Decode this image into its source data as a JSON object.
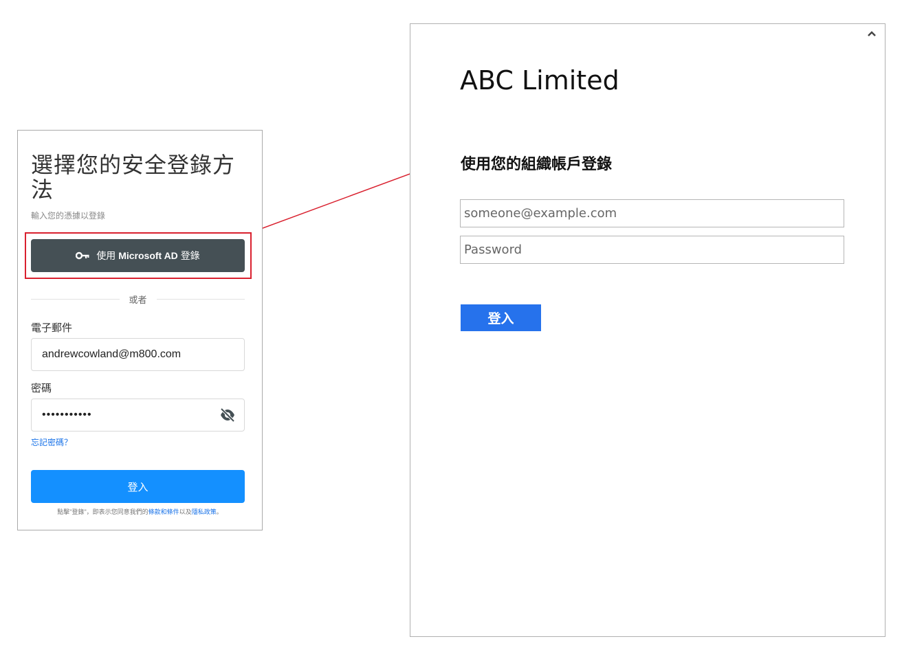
{
  "left_card": {
    "title": "選擇您的安全登錄方法",
    "subtitle": "輸入您的憑據以登錄",
    "ms_button": {
      "prefix": "使用",
      "brand": "Microsoft AD",
      "suffix": "登錄",
      "icon": "key-icon"
    },
    "divider_text": "或者",
    "email_label": "電子郵件",
    "email_value": "andrewcowland@m800.com",
    "password_label": "密碼",
    "password_value": "•••••••••••",
    "password_toggle_icon": "eye-off-icon",
    "forgot_password": "忘記密碼？",
    "login_button": "登入",
    "terms": {
      "prefix": "點擊\"登錄\"，即表示您同意我們的",
      "terms_link": "條款和條件",
      "middle": "以及",
      "privacy_link": "隱私政策",
      "suffix": "。"
    },
    "highlight_color": "#d9202e",
    "button_color": "#455055",
    "login_color": "#1490ff"
  },
  "right_card": {
    "collapse_icon": "chevron-up-icon",
    "org_name": "ABC Limited",
    "heading": "使用您的組織帳戶登錄",
    "email_placeholder": "someone@example.com",
    "password_placeholder": "Password",
    "signin_button": "登入",
    "signin_color": "#2672ec"
  }
}
